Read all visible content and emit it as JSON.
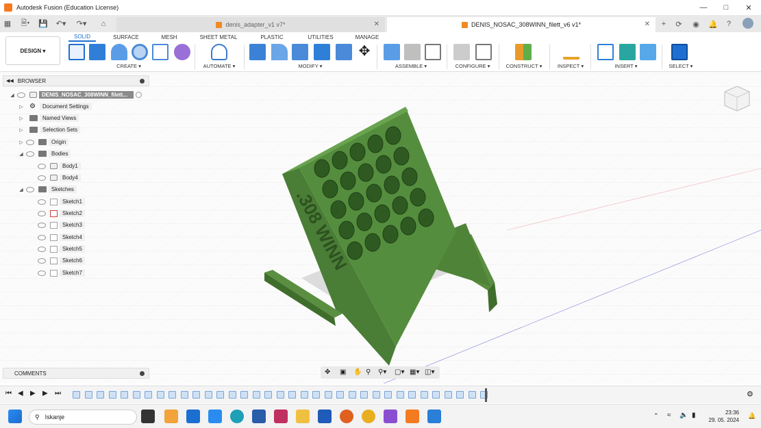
{
  "window": {
    "title": "Autodesk Fusion (Education License)"
  },
  "tabs": [
    {
      "label": "denis_adapter_v1 v7*",
      "active": false
    },
    {
      "label": "DENIS_NOSAC_308WINN_filett_v6 v1*",
      "active": true
    }
  ],
  "toolbar": {
    "design_label": "DESIGN",
    "workspace_tabs": [
      "SOLID",
      "SURFACE",
      "MESH",
      "SHEET METAL",
      "PLASTIC",
      "UTILITIES",
      "MANAGE"
    ],
    "groups": [
      "CREATE",
      "AUTOMATE",
      "MODIFY",
      "ASSEMBLE",
      "CONFIGURE",
      "CONSTRUCT",
      "INSPECT",
      "INSERT",
      "SELECT"
    ]
  },
  "browser": {
    "title": "BROWSER",
    "root": "DENIS_NOSAC_308WINN_filett...",
    "items": [
      "Document Settings",
      "Named Views",
      "Selection Sets",
      "Origin",
      "Bodies",
      "Body1",
      "Body4",
      "Sketches",
      "Sketch1",
      "Sketch2",
      "Sketch3",
      "Sketch4",
      "Sketch5",
      "Sketch6",
      "Sketch7"
    ]
  },
  "comments": {
    "label": "COMMENTS"
  },
  "model": {
    "engraving": ".308 WINN",
    "color": "#4a7d36"
  },
  "taskbar": {
    "search_placeholder": "Iskanje",
    "time": "23:36",
    "date": "29. 05. 2024"
  }
}
